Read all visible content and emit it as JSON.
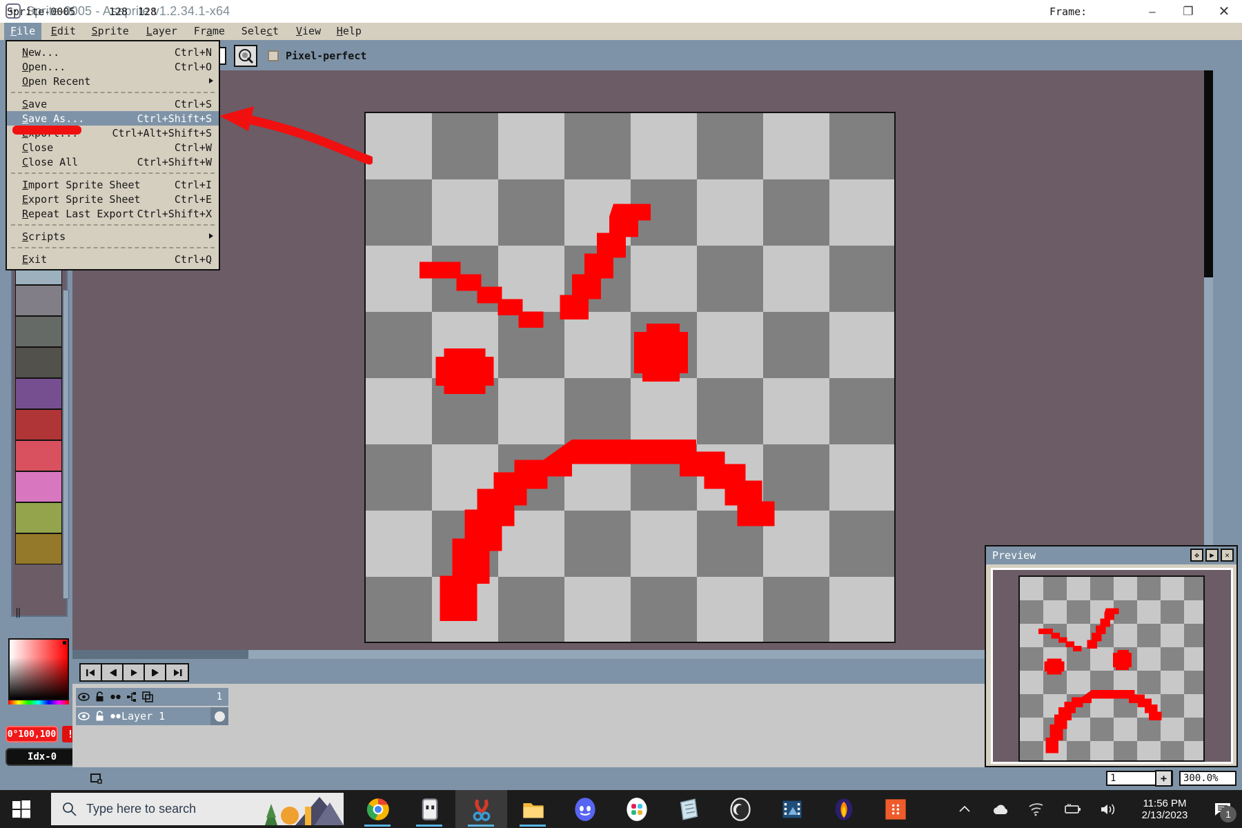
{
  "window": {
    "title": "Sprite-0005 - Aseprite v1.2.34.1-x64",
    "app_icon": "aseprite-icon",
    "minimize": "–",
    "maximize": "❐",
    "close": "✕"
  },
  "menubar": {
    "items": [
      {
        "label": "File",
        "accel": "F",
        "active": true
      },
      {
        "label": "Edit",
        "accel": "E",
        "active": false
      },
      {
        "label": "Sprite",
        "accel": "S",
        "active": false
      },
      {
        "label": "Layer",
        "accel": "L",
        "active": false
      },
      {
        "label": "Frame",
        "accel": "a",
        "active": false
      },
      {
        "label": "Select",
        "accel": "c",
        "active": false
      },
      {
        "label": "View",
        "accel": "V",
        "active": false
      },
      {
        "label": "Help",
        "accel": "H",
        "active": false
      }
    ]
  },
  "file_menu": {
    "rows": [
      {
        "label": "New...",
        "shortcut": "Ctrl+N",
        "sep_after": false,
        "selected": false,
        "submenu": false
      },
      {
        "label": "Open...",
        "shortcut": "Ctrl+O",
        "sep_after": false,
        "selected": false,
        "submenu": false
      },
      {
        "label": "Open Recent",
        "shortcut": "",
        "sep_after": true,
        "selected": false,
        "submenu": true
      },
      {
        "label": "Save",
        "shortcut": "Ctrl+S",
        "sep_after": false,
        "selected": false,
        "submenu": false
      },
      {
        "label": "Save As...",
        "shortcut": "Ctrl+Shift+S",
        "sep_after": false,
        "selected": true,
        "submenu": false
      },
      {
        "label": "Export...",
        "shortcut": "Ctrl+Alt+Shift+S",
        "sep_after": false,
        "selected": false,
        "submenu": false
      },
      {
        "label": "Close",
        "shortcut": "Ctrl+W",
        "sep_after": false,
        "selected": false,
        "submenu": false
      },
      {
        "label": "Close All",
        "shortcut": "Ctrl+Shift+W",
        "sep_after": true,
        "selected": false,
        "submenu": false
      },
      {
        "label": "Import Sprite Sheet",
        "shortcut": "Ctrl+I",
        "sep_after": false,
        "selected": false,
        "submenu": false
      },
      {
        "label": "Export Sprite Sheet",
        "shortcut": "Ctrl+E",
        "sep_after": false,
        "selected": false,
        "submenu": false
      },
      {
        "label": "Repeat Last Export",
        "shortcut": "Ctrl+Shift+X",
        "sep_after": true,
        "selected": false,
        "submenu": false
      },
      {
        "label": "Scripts",
        "shortcut": "",
        "sep_after": true,
        "selected": false,
        "submenu": true
      },
      {
        "label": "Exit",
        "shortcut": "Ctrl+Q",
        "sep_after": false,
        "selected": false,
        "submenu": false
      }
    ]
  },
  "toolbar": {
    "pixel_perfect_label": "Pixel-perfect",
    "pixel_perfect_checked": false,
    "brush_button_icon": "brush-preview-icon"
  },
  "palette": {
    "colors": [
      "#cbd8f5",
      "#ffffff",
      "#9cb0bd",
      "#827e87",
      "#666a66",
      "#53514b",
      "#764f91",
      "#b03537",
      "#d9515f",
      "#d877c0",
      "#93a44c",
      "#94792a"
    ],
    "pause_glyph": "‖"
  },
  "color_picker": {
    "hsv_readout": "0°100,100",
    "warning_glyph": "!",
    "index_readout": "Idx-0"
  },
  "tools": [
    {
      "name": "rectangular-marquee-tool",
      "glyph": "marquee"
    },
    {
      "name": "pencil-tool",
      "glyph": "pencil"
    },
    {
      "name": "eraser-tool",
      "glyph": "eraser"
    },
    {
      "name": "eyedropper-tool",
      "glyph": "eyedropper"
    },
    {
      "name": "zoom-tool",
      "glyph": "magnifier"
    },
    {
      "name": "move-tool",
      "glyph": "move"
    },
    {
      "name": "paint-bucket-tool",
      "glyph": "bucket"
    },
    {
      "name": "line-tool",
      "glyph": "line"
    },
    {
      "name": "ellipse-tool",
      "glyph": "ellipse"
    },
    {
      "name": "contour-tool",
      "glyph": "blob"
    },
    {
      "name": "spray-tool",
      "glyph": "spray"
    }
  ],
  "timeline": {
    "nav_buttons": [
      {
        "name": "go-to-first-frame",
        "glyph": "⏮"
      },
      {
        "name": "go-to-previous-frame",
        "glyph": "⏴"
      },
      {
        "name": "play-animation",
        "glyph": "▶"
      },
      {
        "name": "go-to-next-frame",
        "glyph": "⏵"
      },
      {
        "name": "go-to-last-frame",
        "glyph": "⏭"
      }
    ],
    "header_icons": [
      "eye-icon",
      "padlock-icon",
      "continuous-icon",
      "group-icon",
      "onion-skin-icon"
    ],
    "frame_number": "1",
    "layer": {
      "name": "Layer 1",
      "visible_icon": "eye-icon",
      "lock_icon": "padlock-icon",
      "continuous_icon": "continuous-icon"
    }
  },
  "preview": {
    "title": "Preview",
    "buttons": [
      {
        "name": "preview-fit-button",
        "glyph": "✥"
      },
      {
        "name": "preview-play-button",
        "glyph": "▶"
      },
      {
        "name": "preview-close-button",
        "glyph": "✕"
      }
    ]
  },
  "statusbar": {
    "sprite_name": "Sprite-0005",
    "size_icon": "canvas-size-icon",
    "width": "128",
    "height": "128",
    "frame_label": "Frame:",
    "frame_value": "1",
    "plus_label": "+",
    "zoom_value": "300.0%"
  },
  "taskbar": {
    "start_icon": "windows-logo-icon",
    "search_placeholder": "Type here to search",
    "search_icon": "search-icon",
    "apps": [
      {
        "name": "chrome-taskbar-icon",
        "active": false,
        "running": true
      },
      {
        "name": "aseprite-taskbar-icon",
        "active": false,
        "running": true
      },
      {
        "name": "snip-sketch-taskbar-icon",
        "active": true,
        "running": true
      },
      {
        "name": "file-explorer-taskbar-icon",
        "active": false,
        "running": true
      },
      {
        "name": "discord-taskbar-icon",
        "active": false,
        "running": false
      },
      {
        "name": "slack-taskbar-icon",
        "active": false,
        "running": false
      },
      {
        "name": "notepad-taskbar-icon",
        "active": false,
        "running": false
      },
      {
        "name": "obs-taskbar-icon",
        "active": false,
        "running": false
      },
      {
        "name": "video-editor-taskbar-icon",
        "active": false,
        "running": false
      },
      {
        "name": "firefox-taskbar-icon",
        "active": false,
        "running": false
      },
      {
        "name": "orange-app-taskbar-icon",
        "active": false,
        "running": false
      }
    ],
    "tray": [
      {
        "name": "show-hidden-icons-chevron",
        "glyph": "⌃"
      },
      {
        "name": "onedrive-icon",
        "glyph": "cloud"
      },
      {
        "name": "wifi-icon",
        "glyph": "wifi"
      },
      {
        "name": "battery-icon",
        "glyph": "battery"
      },
      {
        "name": "volume-icon",
        "glyph": "speaker"
      }
    ],
    "clock_time": "11:56 PM",
    "clock_date": "2/13/2023",
    "notification_count": "1"
  },
  "annotation": {
    "arrow_color": "#f01010",
    "strike_color": "#f01010",
    "points_to": "Save As..."
  },
  "canvas": {
    "sprite_strokes": "sad-face-drawing",
    "stroke_color": "#ff0000"
  }
}
